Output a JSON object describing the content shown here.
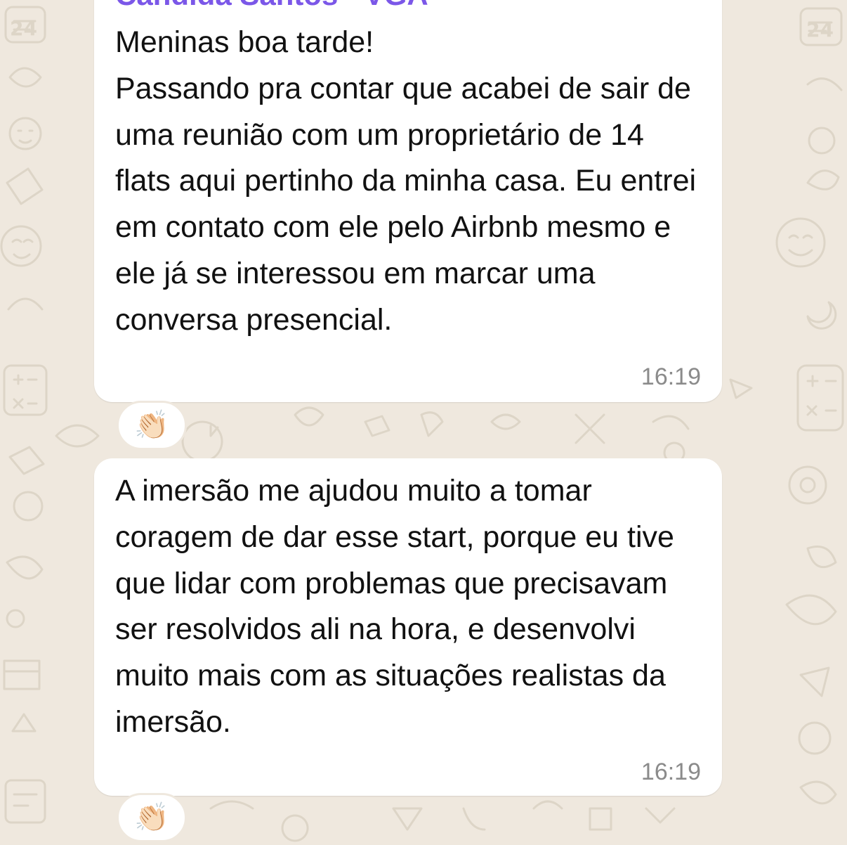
{
  "colors": {
    "background": "#efe8de",
    "bubble": "#ffffff",
    "sender_name": "#7b57e8",
    "timestamp": "#8b8b8b"
  },
  "messages": [
    {
      "sender": "Candida Santos - VGA",
      "text": "Meninas boa tarde!\nPassando pra contar que acabei de sair de uma reunião com um proprietário de 14 flats aqui pertinho da minha casa. Eu entrei em contato com ele pelo Airbnb mesmo e ele já se interessou em marcar uma conversa presencial.",
      "time": "16:19",
      "reaction": "👏🏻",
      "reaction_icon": "clapping-hands-icon"
    },
    {
      "text": "A imersão me ajudou muito a tomar coragem de dar esse start, porque eu tive que lidar com problemas que precisavam ser resolvidos ali na hora, e desenvolvi muito mais com as situações realistas da imersão.",
      "time": "16:19",
      "reaction": "👏🏻",
      "reaction_icon": "clapping-hands-icon"
    }
  ]
}
